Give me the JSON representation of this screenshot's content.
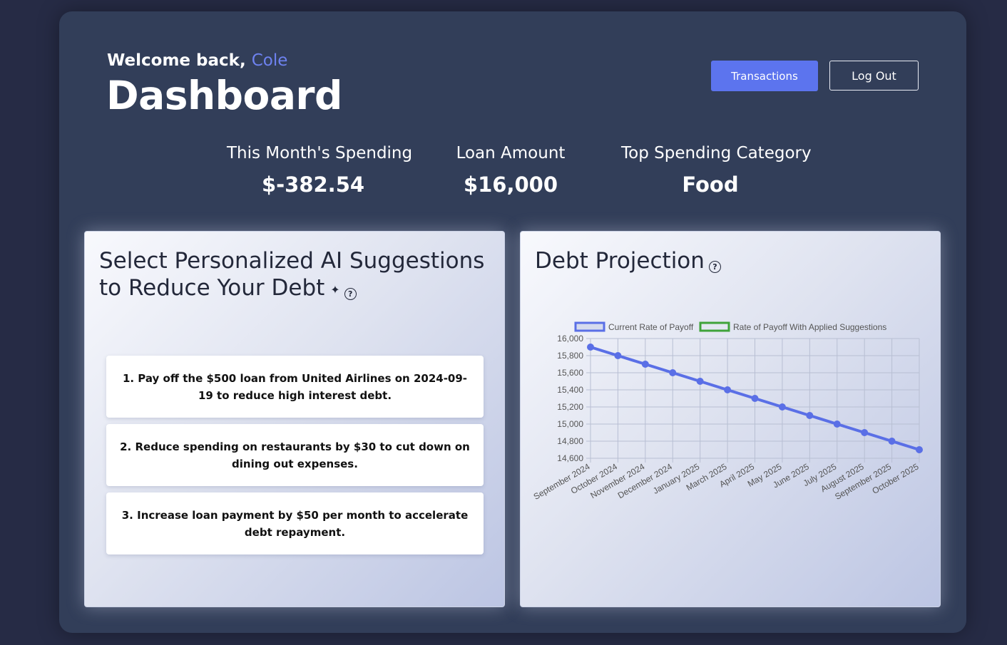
{
  "header": {
    "welcome_prefix": "Welcome back,",
    "username": "Cole",
    "title": "Dashboard",
    "transactions_label": "Transactions",
    "logout_label": "Log Out"
  },
  "stats": [
    {
      "label": "This Month's Spending",
      "value": "$-382.54"
    },
    {
      "label": "Loan Amount",
      "value": "$16,000"
    },
    {
      "label": "Top Spending Category",
      "value": "Food"
    }
  ],
  "suggestions_card": {
    "title_line1": "Select Personalized AI Suggestions",
    "title_line2": "to Reduce Your Debt",
    "items": [
      "1. Pay off the $500 loan from United Airlines on 2024-09-19 to reduce high interest debt.",
      "2. Reduce spending on restaurants by $30 to cut down on dining out expenses.",
      "3. Increase loan payment by $50 per month to accelerate debt repayment."
    ]
  },
  "projection_card": {
    "title": "Debt Projection"
  },
  "colors": {
    "accent": "#5c74ee",
    "username": "#6e82f0",
    "series_current": "#5a6fe6",
    "series_suggested": "#3fa33a"
  },
  "icons": [
    "sparkle-icon",
    "help-icon"
  ],
  "chart_data": {
    "type": "line",
    "categories": [
      "September 2024",
      "October 2024",
      "November 2024",
      "December 2024",
      "January 2025",
      "March 2025",
      "April 2025",
      "May 2025",
      "June 2025",
      "July 2025",
      "August 2025",
      "September 2025",
      "October 2025"
    ],
    "series": [
      {
        "name": "Current Rate of Payoff",
        "values": [
          15900,
          15800,
          15700,
          15600,
          15500,
          15400,
          15300,
          15200,
          15100,
          15000,
          14900,
          14800,
          14700
        ]
      },
      {
        "name": "Rate of Payoff With Applied Suggestions",
        "values": []
      }
    ],
    "yticks": [
      "16,000",
      "15,800",
      "15,600",
      "15,400",
      "15,200",
      "15,000",
      "14,800",
      "14,600"
    ],
    "ylim": [
      14600,
      16000
    ],
    "grid": true,
    "legend": "top"
  }
}
